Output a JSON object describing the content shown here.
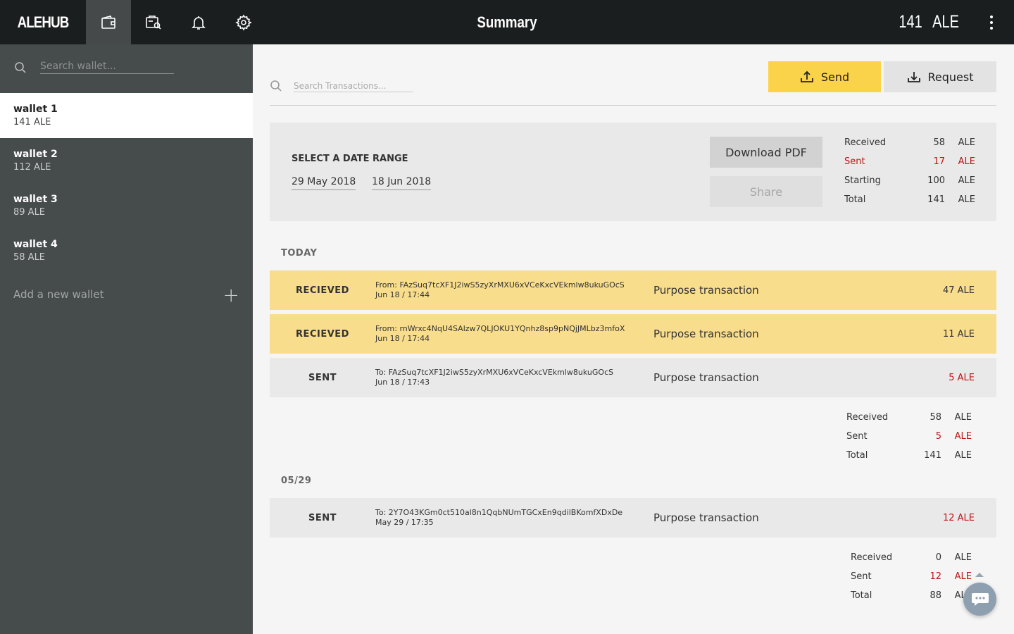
{
  "app": {
    "logo": "ALEHUB",
    "title": "Summary",
    "balance_amount": "141",
    "balance_unit": "ALE"
  },
  "nav": [
    {
      "icon": "wallet-icon",
      "active": true
    },
    {
      "icon": "wallet-search-icon",
      "active": false
    },
    {
      "icon": "bell-icon",
      "active": false
    },
    {
      "icon": "gear-icon",
      "active": false
    }
  ],
  "sidebar": {
    "search_placeholder": "Search wallet...",
    "wallets": [
      {
        "name": "wallet 1",
        "balance": "141 ALE",
        "active": true
      },
      {
        "name": "wallet 2",
        "balance": "112 ALE",
        "active": false
      },
      {
        "name": "wallet 3",
        "balance": "89 ALE",
        "active": false
      },
      {
        "name": "wallet 4",
        "balance": "58 ALE",
        "active": false
      }
    ],
    "add_wallet_label": "Add a new wallet",
    "add_wallet_icon": "+"
  },
  "main": {
    "search_placeholder": "Search Transactions...",
    "send_label": "Send",
    "request_label": "Request",
    "range": {
      "title": "SELECT A DATE RANGE",
      "from": "29 May 2018",
      "to": "18 Jun 2018",
      "download_label": "Download PDF",
      "share_label": "Share",
      "stats": [
        {
          "label": "Received",
          "value": "58",
          "unit": "ALE",
          "red": false
        },
        {
          "label": "Sent",
          "value": "17",
          "unit": "ALE",
          "red": true
        },
        {
          "label": "Starting",
          "value": "100",
          "unit": "ALE",
          "red": false
        },
        {
          "label": "Total",
          "value": "141",
          "unit": "ALE",
          "red": false
        }
      ]
    },
    "groups": [
      {
        "label": "TODAY",
        "transactions": [
          {
            "type": "RECIEVED",
            "kind": "received",
            "address": "From: FAzSuq7tcXF1J2iwS5zyXrMXU6xVCeKxcVEkmlw8ukuGOcS",
            "datetime": "Jun 18 / 17:44",
            "purpose": "Purpose transaction",
            "amount": "47 ALE"
          },
          {
            "type": "RECIEVED",
            "kind": "received",
            "address": "From: rnWrxc4NqU4SAlzw7QLJOKU1YQnhz8sp9pNQjJMLbz3mfoX",
            "datetime": "Jun 18 / 17:44",
            "purpose": "Purpose transaction",
            "amount": "11 ALE"
          },
          {
            "type": "SENT",
            "kind": "sent",
            "address": "To: FAzSuq7tcXF1J2iwS5zyXrMXU6xVCeKxcVEkmlw8ukuGOcS",
            "datetime": "Jun 18 / 17:43",
            "purpose": "Purpose transaction",
            "amount": "5 ALE"
          }
        ],
        "stats": [
          {
            "label": "Received",
            "value": "58",
            "unit": "ALE",
            "red": false
          },
          {
            "label": "Sent",
            "value": "5",
            "unit": "ALE",
            "red": true
          },
          {
            "label": "Total",
            "value": "141",
            "unit": "ALE",
            "red": false
          }
        ]
      },
      {
        "label": "05/29",
        "transactions": [
          {
            "type": "SENT",
            "kind": "sent",
            "address": "To: 2Y7O43KGm0ct510al8n1QqbNUmTGCxEn9qdilBKomfXDxDe",
            "datetime": "May 29 / 17:35",
            "purpose": "Purpose transaction",
            "amount": "12 ALE"
          }
        ],
        "stats": [
          {
            "label": "Received",
            "value": "0",
            "unit": "ALE",
            "red": false
          },
          {
            "label": "Sent",
            "value": "12",
            "unit": "ALE",
            "red": true
          },
          {
            "label": "Total",
            "value": "88",
            "unit": "ALE",
            "red": false
          }
        ]
      }
    ]
  },
  "colors": {
    "topbar": "#1b1e1e",
    "sidebar": "#464b4b",
    "accent_yellow": "#fbd34b",
    "received_row": "#f8dd8c",
    "sent_amount_red": "#c01414"
  }
}
